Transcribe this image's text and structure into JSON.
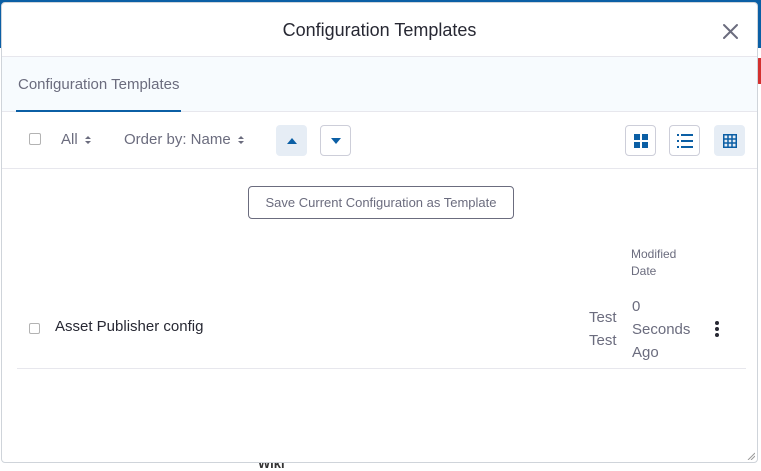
{
  "modal": {
    "title": "Configuration Templates"
  },
  "navbar": {
    "active_tab": "Configuration Templates"
  },
  "management_bar": {
    "filter_label": "All",
    "order_label": "Order by: Name",
    "sort_direction": "ascending",
    "view_mode": "table"
  },
  "actions": {
    "save_template_label": "Save Current Configuration as Template"
  },
  "table": {
    "columns": {
      "modified_date": [
        "Modified",
        "Date"
      ]
    },
    "rows": [
      {
        "title": "Asset Publisher config",
        "author": [
          "Test",
          "Test"
        ],
        "modified": [
          "0",
          "Seconds",
          "Ago"
        ]
      }
    ]
  },
  "background": {
    "partial_text": "Wiki"
  },
  "colors": {
    "primary": "#0b5fa5",
    "text": "#272833",
    "secondary_text": "#6b6c7e",
    "active_bg": "#e6edf5"
  }
}
